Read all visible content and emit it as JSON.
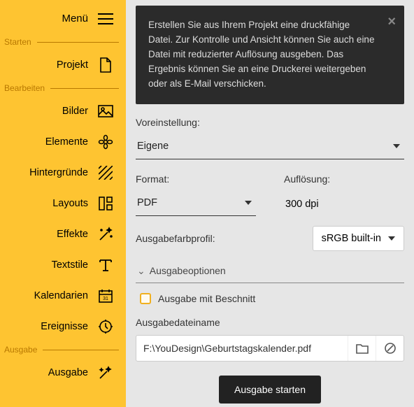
{
  "menu": {
    "label": "Menü"
  },
  "sections": {
    "starten": "Starten",
    "bearbeiten": "Bearbeiten",
    "ausgabe": "Ausgabe"
  },
  "nav": {
    "projekt": "Projekt",
    "bilder": "Bilder",
    "elemente": "Elemente",
    "hintergruende": "Hintergründe",
    "layouts": "Layouts",
    "effekte": "Effekte",
    "textstile": "Textstile",
    "kalendarien": "Kalendarien",
    "ereignisse": "Ereignisse",
    "ausgabe": "Ausgabe"
  },
  "notice": {
    "text": "Erstellen Sie aus Ihrem Projekt eine druckfähige Datei. Zur Kontrolle und Ansicht können Sie auch eine Datei mit reduzierter Auflösung ausgeben. Das Ergebnis können Sie an eine Druckerei weitergeben oder als E-Mail verschicken."
  },
  "form": {
    "preset_label": "Voreinstellung:",
    "preset_value": "Eigene",
    "format_label": "Format:",
    "format_value": "PDF",
    "resolution_label": "Auflösung:",
    "resolution_value": "300 dpi",
    "profile_label": "Ausgabefarbprofil:",
    "profile_value": "sRGB built-in",
    "options_header": "Ausgabeoptionen",
    "bleed_label": "Ausgabe mit Beschnitt",
    "filename_label": "Ausgabedateiname",
    "filename_value": "F:\\YouDesign\\Geburtstagskalender.pdf",
    "start_label": "Ausgabe starten"
  }
}
